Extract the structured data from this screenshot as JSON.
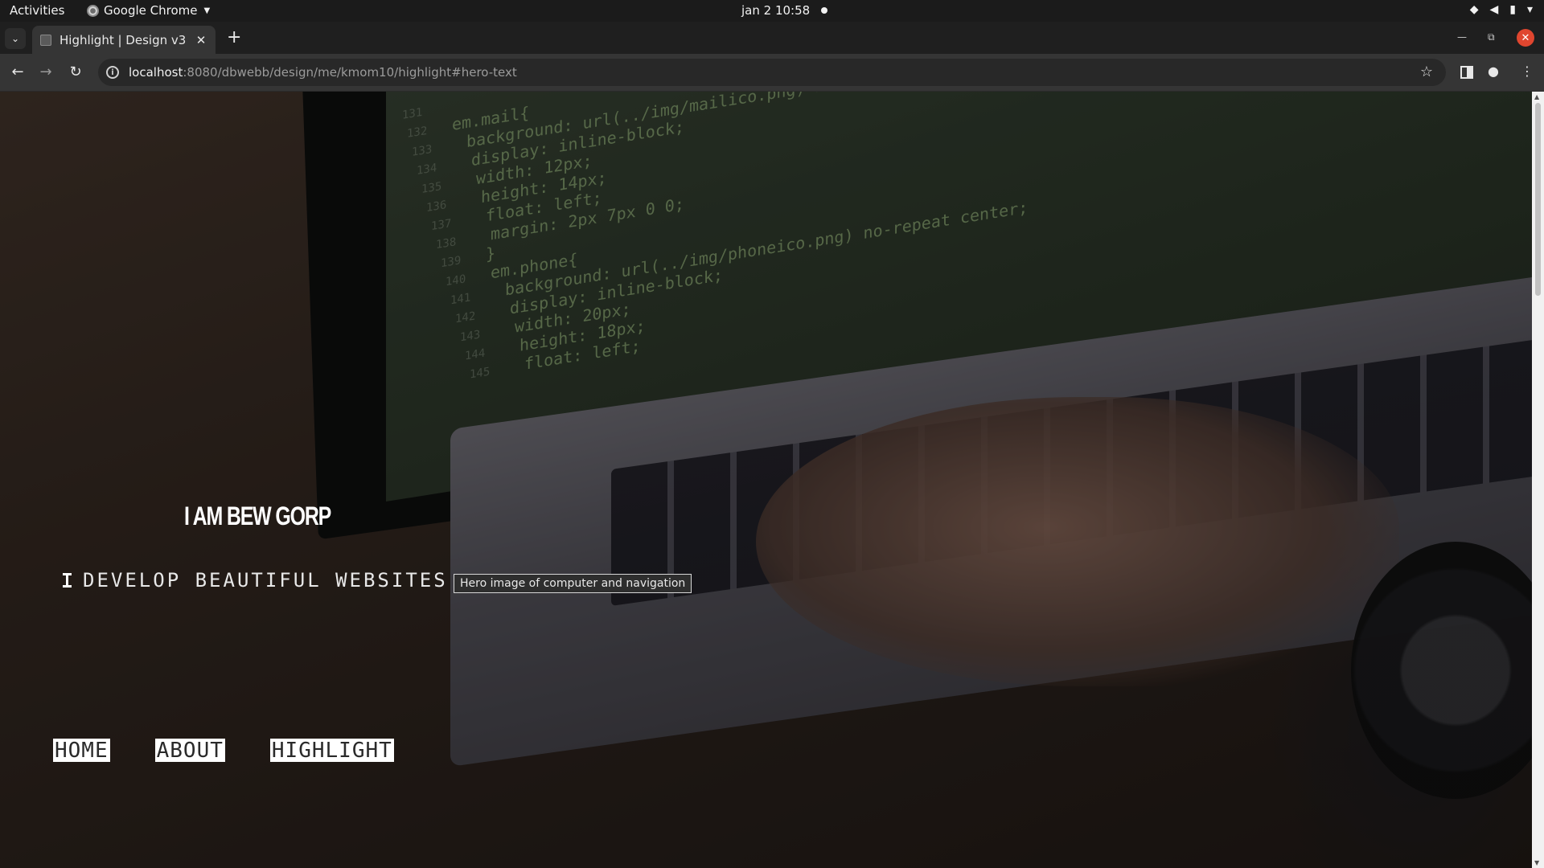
{
  "topbar": {
    "activities": "Activities",
    "app_name": "Google Chrome",
    "clock": "jan 2  10:58"
  },
  "browser": {
    "tab_title": "Highlight | Design v3",
    "url_host": "localhost",
    "url_path": ":8080/dbwebb/design/me/kmom10/highlight#hero-text"
  },
  "page": {
    "hero_title": "I AM BEW GORP",
    "hero_subtitle": "DEVELOP BEAUTIFUL WEBSITES",
    "nav": [
      "HOME",
      "ABOUT",
      "HIGHLIGHT"
    ],
    "tooltip": "Hero image of computer and navigation",
    "code_lines": [
      {
        "n": "131",
        "t": ""
      },
      {
        "n": "132",
        "t": "em.mail{"
      },
      {
        "n": "133",
        "t": "  background: url(../img/mailico.png) no-repeat center;"
      },
      {
        "n": "134",
        "t": "  display: inline-block;"
      },
      {
        "n": "135",
        "t": "  width: 12px;"
      },
      {
        "n": "136",
        "t": "  height: 14px;"
      },
      {
        "n": "137",
        "t": "  float: left;"
      },
      {
        "n": "138",
        "t": "  margin: 2px 7px 0 0;"
      },
      {
        "n": "139",
        "t": "}"
      },
      {
        "n": "140",
        "t": "em.phone{"
      },
      {
        "n": "141",
        "t": "  background: url(../img/phoneico.png) no-repeat center;"
      },
      {
        "n": "142",
        "t": "  display: inline-block;"
      },
      {
        "n": "143",
        "t": "  width: 20px;"
      },
      {
        "n": "144",
        "t": "  height: 18px;"
      },
      {
        "n": "145",
        "t": "  float: left;"
      }
    ]
  }
}
